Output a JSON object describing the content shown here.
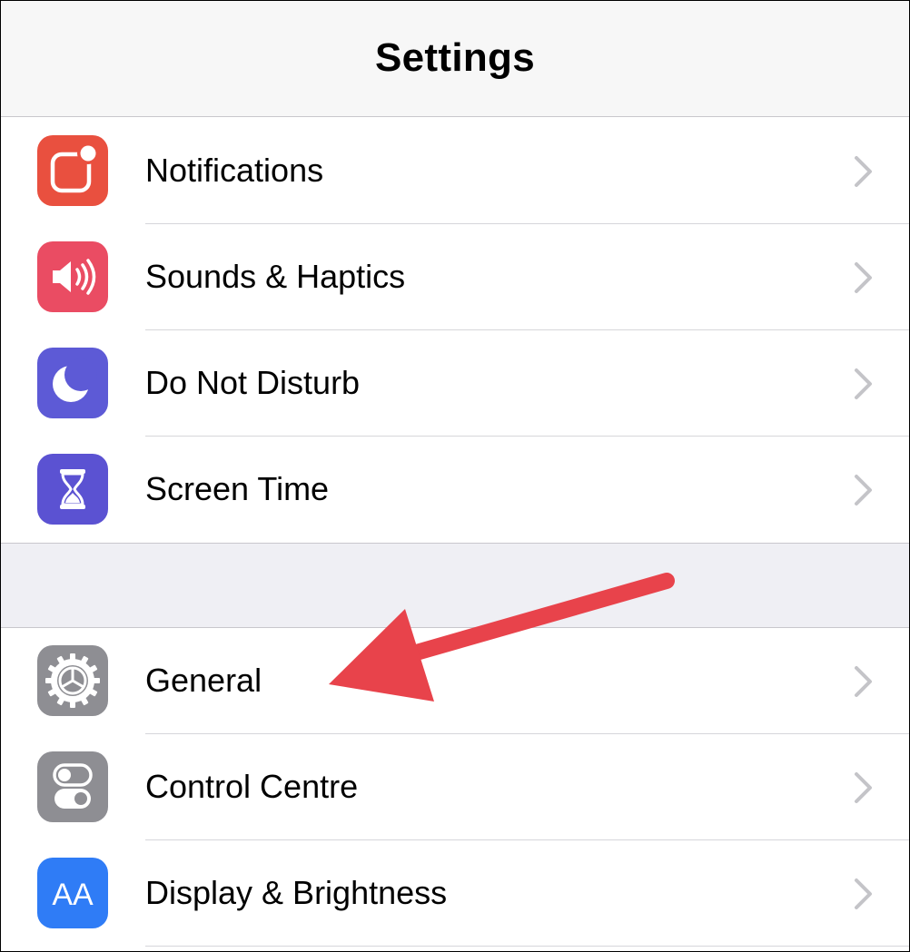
{
  "header": {
    "title": "Settings"
  },
  "colors": {
    "notifications": "#e9503f",
    "sounds": "#ea4c63",
    "do_not_disturb": "#5d5ad6",
    "screen_time": "#5b52d2",
    "general": "#8e8e93",
    "control_centre": "#8e8e93",
    "display": "#2f7cf6",
    "annotation_arrow": "#e8434b"
  },
  "groups": [
    {
      "items": [
        {
          "label": "Notifications",
          "icon": "notifications-icon"
        },
        {
          "label": "Sounds & Haptics",
          "icon": "speaker-icon"
        },
        {
          "label": "Do Not Disturb",
          "icon": "moon-icon"
        },
        {
          "label": "Screen Time",
          "icon": "hourglass-icon"
        }
      ]
    },
    {
      "items": [
        {
          "label": "General",
          "icon": "gear-icon"
        },
        {
          "label": "Control Centre",
          "icon": "toggles-icon"
        },
        {
          "label": "Display & Brightness",
          "icon": "text-size-icon",
          "icon_text": "AA"
        }
      ]
    }
  ],
  "annotation": {
    "type": "arrow",
    "points_to": "General"
  }
}
